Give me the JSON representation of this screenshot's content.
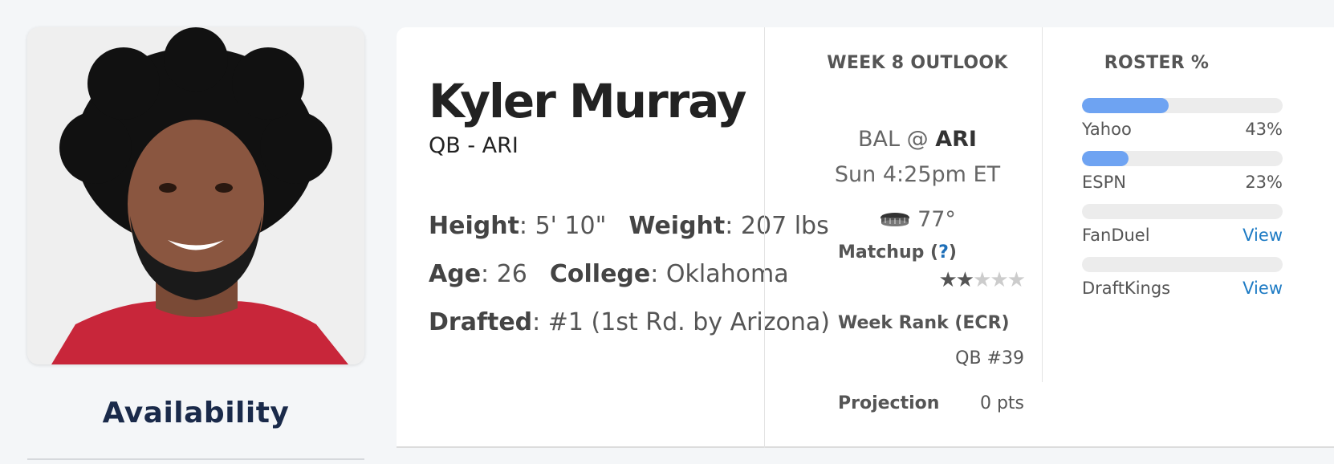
{
  "player": {
    "name": "Kyler Murray",
    "position_team": "QB - ARI",
    "height_label": "Height",
    "height_value": ": 5' 10\"",
    "weight_label": "Weight",
    "weight_value": ": 207 lbs",
    "age_label": "Age",
    "age_value": ": 26",
    "college_label": "College",
    "college_value": ": Oklahoma",
    "drafted_label": "Drafted",
    "drafted_value": ": #1 (1st Rd. by Arizona)"
  },
  "availability": {
    "heading": "Availability"
  },
  "outlook": {
    "heading": "WEEK 8 OUTLOOK",
    "away": "BAL @ ",
    "home": "ARI",
    "kickoff": "Sun 4:25pm ET",
    "weather_icon": "stadium-icon",
    "temperature": "77°",
    "matchup_label": "Matchup (",
    "matchup_help": "?",
    "matchup_close": ")",
    "matchup_stars": 2,
    "matchup_stars_max": 5,
    "week_rank_label": "Week Rank (ECR)",
    "week_rank_value": "QB #39",
    "projection_label": "Projection",
    "projection_value": "0 pts"
  },
  "roster": {
    "heading": "ROSTER %",
    "sites": [
      {
        "name": "Yahoo",
        "value": "43%",
        "pct": 43,
        "link": false
      },
      {
        "name": "ESPN",
        "value": "23%",
        "pct": 23,
        "link": false
      },
      {
        "name": "FanDuel",
        "value": "View",
        "pct": 0,
        "link": true
      },
      {
        "name": "DraftKings",
        "value": "View",
        "pct": 0,
        "link": true
      }
    ]
  },
  "colors": {
    "bar_fill": "#6ea3f2",
    "link": "#1e7bc4",
    "jersey": "#c8263a"
  }
}
